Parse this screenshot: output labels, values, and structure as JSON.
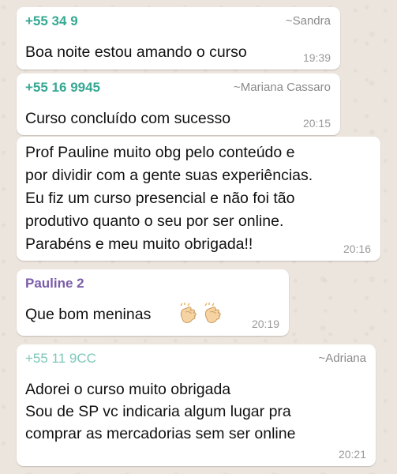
{
  "messages": [
    {
      "sender": "+55 34 9",
      "pushname": "~Sandra",
      "text": "Boa noite estou amando o curso",
      "time": "19:39"
    },
    {
      "sender": "+55 16 9945",
      "pushname": "~Mariana Cassaro",
      "text": "Curso concluído com sucesso",
      "time": "20:15"
    },
    {
      "lines": [
        "Prof Pauline muito obg pelo conteúdo e",
        "por dividir com a gente suas experiências.",
        "Eu fiz um curso presencial e não foi tão",
        "produtivo quanto o seu por ser online.",
        "Parabéns e meu muito obrigada!!"
      ],
      "time": "20:16"
    },
    {
      "sender": "Pauline 2",
      "text": "Que bom meninas",
      "emoji": [
        "clapping-hands-icon",
        "clapping-hands-icon"
      ],
      "time": "20:19"
    },
    {
      "sender": "+55 11 9CC",
      "pushname": "~Adriana",
      "lines": [
        "Adorei o curso muito obrigada",
        "Sou de SP vc indicaria algum lugar pra",
        "comprar as mercadorias sem ser online"
      ],
      "time": "20:21"
    }
  ],
  "colors": {
    "chat_background": "#ece5dd",
    "bubble": "#ffffff",
    "sender_teal": "#35a893",
    "sender_purple": "#7b5ca8",
    "pushname_gray": "#8a8a8a",
    "time_gray": "#9a9a9a"
  }
}
